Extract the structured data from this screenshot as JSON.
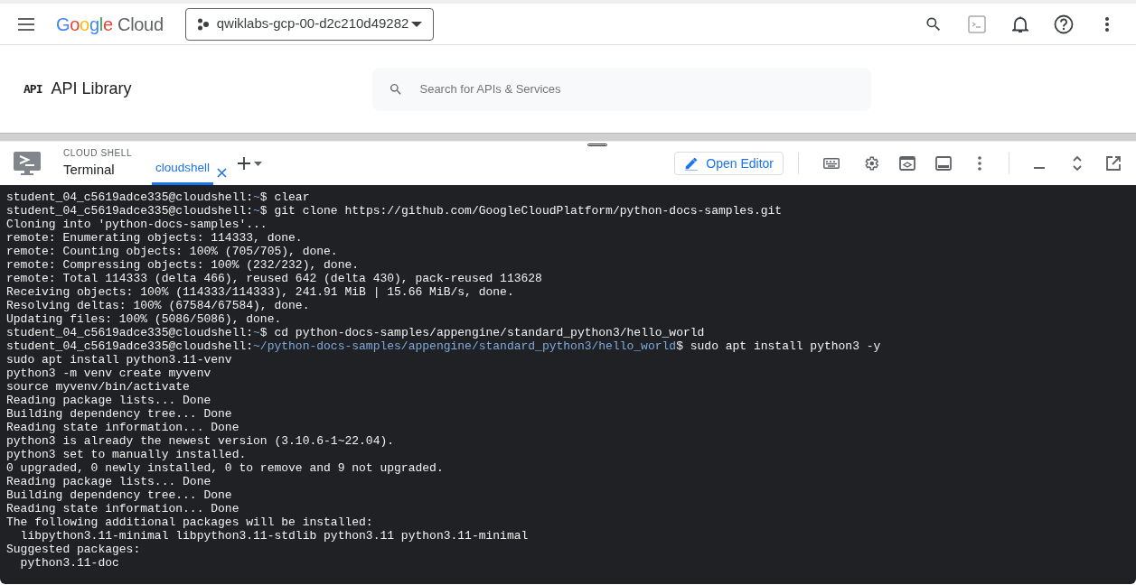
{
  "header": {
    "logo": {
      "brand": "Google",
      "product": "Cloud"
    },
    "project": "qwiklabs-gcp-00-d2c210d49282"
  },
  "page": {
    "icon_text": "API",
    "title": "API Library",
    "search": {
      "placeholder": "Search for APIs & Services"
    }
  },
  "cloud_shell": {
    "label": "CLOUD SHELL",
    "title": "Terminal",
    "tabs": [
      {
        "label": "cloudshell",
        "selected": true
      }
    ],
    "open_editor": "Open Editor"
  },
  "terminal": {
    "lines": [
      {
        "kind": "prompt",
        "host": "student_04_c5619adce335@cloudshell:",
        "path": "~",
        "command": "$ clear"
      },
      {
        "kind": "prompt",
        "host": "student_04_c5619adce335@cloudshell:",
        "path": "~",
        "command": "$ git clone https://github.com/GoogleCloudPlatform/python-docs-samples.git"
      },
      {
        "kind": "output",
        "text": "Cloning into 'python-docs-samples'..."
      },
      {
        "kind": "output",
        "text": "remote: Enumerating objects: 114333, done."
      },
      {
        "kind": "output",
        "text": "remote: Counting objects: 100% (705/705), done."
      },
      {
        "kind": "output",
        "text": "remote: Compressing objects: 100% (232/232), done."
      },
      {
        "kind": "output",
        "text": "remote: Total 114333 (delta 466), reused 642 (delta 430), pack-reused 113628"
      },
      {
        "kind": "output",
        "text": "Receiving objects: 100% (114333/114333), 241.91 MiB | 15.66 MiB/s, done."
      },
      {
        "kind": "output",
        "text": "Resolving deltas: 100% (67584/67584), done."
      },
      {
        "kind": "output",
        "text": "Updating files: 100% (5086/5086), done."
      },
      {
        "kind": "prompt",
        "host": "student_04_c5619adce335@cloudshell:",
        "path": "~",
        "command": "$ cd python-docs-samples/appengine/standard_python3/hello_world"
      },
      {
        "kind": "prompt",
        "host": "student_04_c5619adce335@cloudshell:",
        "path": "~/python-docs-samples/appengine/standard_python3/hello_world",
        "command": "$ sudo apt install python3 -y"
      },
      {
        "kind": "output",
        "text": "sudo apt install python3.11-venv"
      },
      {
        "kind": "output",
        "text": "python3 -m venv create myvenv"
      },
      {
        "kind": "output",
        "text": "source myvenv/bin/activate"
      },
      {
        "kind": "output",
        "text": "Reading package lists... Done"
      },
      {
        "kind": "output",
        "text": "Building dependency tree... Done"
      },
      {
        "kind": "output",
        "text": "Reading state information... Done"
      },
      {
        "kind": "output",
        "text": "python3 is already the newest version (3.10.6-1~22.04)."
      },
      {
        "kind": "output",
        "text": "python3 set to manually installed."
      },
      {
        "kind": "output",
        "text": "0 upgraded, 0 newly installed, 0 to remove and 9 not upgraded."
      },
      {
        "kind": "output",
        "text": "Reading package lists... Done"
      },
      {
        "kind": "output",
        "text": "Building dependency tree... Done"
      },
      {
        "kind": "output",
        "text": "Reading state information... Done"
      },
      {
        "kind": "output",
        "text": "The following additional packages will be installed:"
      },
      {
        "kind": "output",
        "text": "  libpython3.11-minimal libpython3.11-stdlib python3.11 python3.11-minimal"
      },
      {
        "kind": "output",
        "text": "Suggested packages:"
      },
      {
        "kind": "output",
        "text": "  python3.11-doc"
      }
    ]
  }
}
